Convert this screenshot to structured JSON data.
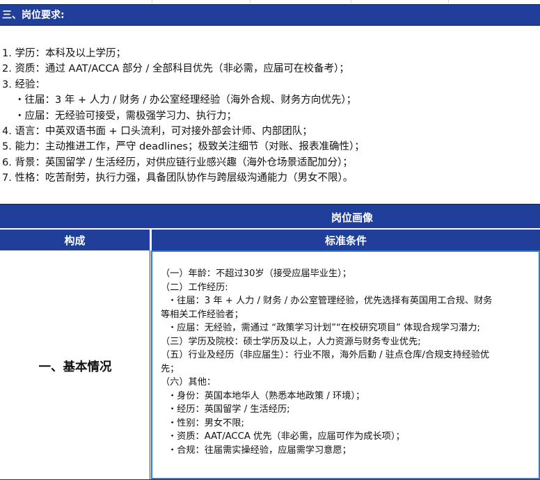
{
  "section": {
    "title": "三、岗位要求:"
  },
  "requirements": [
    "1. 学历：本科及以上学历；",
    "2. 资质：通过 AAT/ACCA 部分 / 全部科目优先（非必需，应届可在校备考）；",
    "3. 经验：",
    "・往届：3 年 + 人力 / 财务 / 办公室经理经验（海外合规、财务方向优先）；",
    "・应届：无经验可接受，需极强学习力、执行力；",
    "4. 语言：中英双语书面 + 口头流利，可对接外部会计师、内部团队；",
    "5. 能力：主动推进工作，严守 deadlines；极致关注细节（对账、报表准确性）；",
    "6. 背景：英国留学 / 生活经历，对供应链行业感兴趣（海外仓场景适配加分）；",
    "7. 性格：吃苦耐劳，执行力强，具备团队协作与跨层级沟通能力（男女不限）。"
  ],
  "table": {
    "title": "岗位画像",
    "col1": "构成",
    "col2": "标准条件",
    "row_label": "一、基本情况",
    "lines": [
      "（一）年龄：不超过30岁（接受应届毕业生）；",
      "（二）工作经历:",
      "・往届：3 年 + 人力 / 财务 / 办公室管理经验，优先选择有英国用工合规、财务",
      "等相关工作经验者；",
      "・应届：无经验，需通过 “政策学习计划”“在校研究项目” 体现合规学习潜力;",
      "（三）学历及院校：硕士学历及以上，人力资源与财务专业优先;",
      "（五）行业及经历（非应届生）：行业不限，海外后勤 / 驻点仓库/合规支持经验优",
      "先；",
      "（六）其他：",
      "・身份：英国本地华人（熟悉本地政策 / 环境）；",
      "・经历：英国留学 / 生活经历;",
      "・性别：男女不限;",
      "・资质：AAT/ACCA 优先（非必需，应届可作为成长项）；",
      "・合规：往届需实操经验，应届需学习意愿；"
    ]
  }
}
